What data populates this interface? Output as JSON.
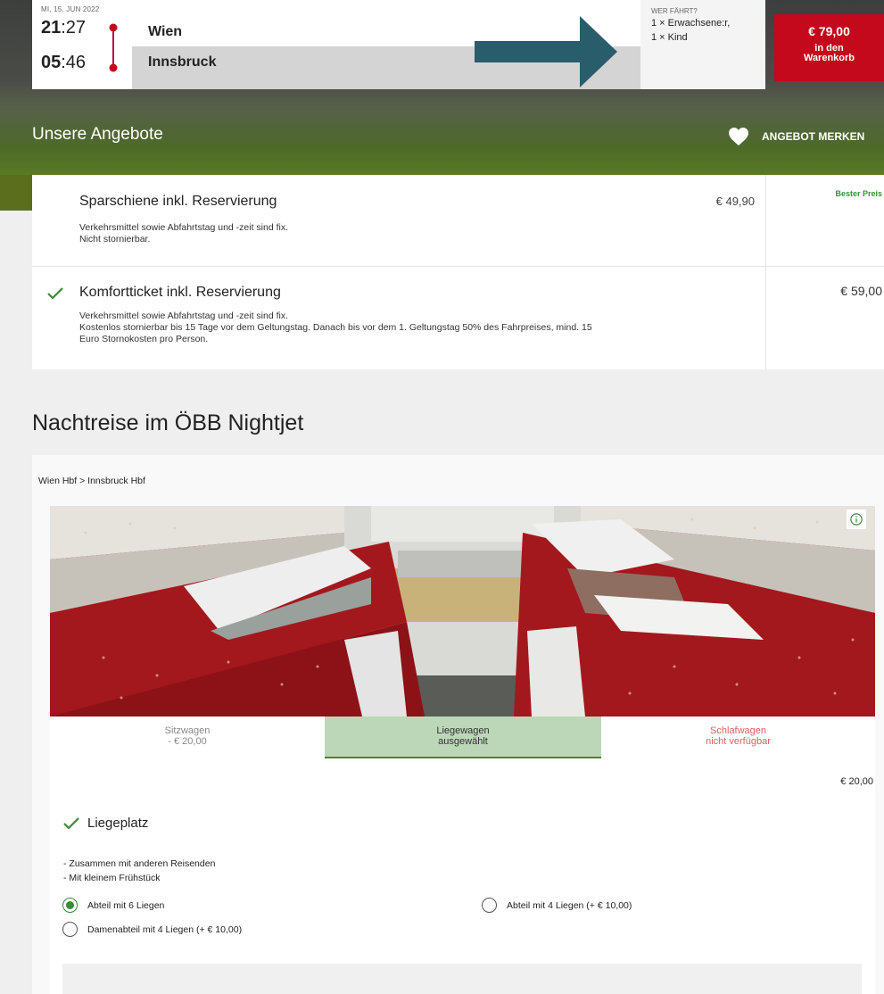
{
  "trip": {
    "date": "MI, 15. JUN 2022",
    "departure_hour": "21",
    "departure_min": ":27",
    "arrival_hour": "05",
    "arrival_min": ":46",
    "from": "Wien",
    "to": "Innsbruck"
  },
  "passengers": {
    "label": "WER FÄHRT?",
    "lines": [
      "1 × Erwachsene:r,",
      "1 × Kind"
    ]
  },
  "cart": {
    "price": "€ 79,00",
    "label_line1": "in den",
    "label_line2": "Warenkorb",
    "color": "#c3091b"
  },
  "offers": {
    "title": "Unsere Angebote",
    "save_label": "ANGEBOT MERKEN",
    "items": [
      {
        "name": "Sparschiene inkl. Reservierung",
        "price": "€ 49,90",
        "badge": "Bester Preis",
        "desc_lines": [
          "Verkehrsmittel sowie Abfahrtstag und -zeit sind fix.",
          "Nicht stornierbar."
        ],
        "selected": false
      },
      {
        "name": "Komfortticket inkl. Reservierung",
        "price": "€ 59,00",
        "desc_lines": [
          "Verkehrsmittel sowie Abfahrtstag und -zeit sind fix.",
          "Kostenlos stornierbar bis 15 Tage vor dem Geltungstag. Danach bis vor dem 1. Geltungstag 50% des Fahrpreises, mind. 15",
          "Euro Stornokosten pro Person."
        ],
        "selected": true
      }
    ]
  },
  "nightjet": {
    "title": "Nachtreise im ÖBB Nightjet",
    "route": "Wien Hbf > Innsbruck Hbf",
    "tabs": [
      {
        "name": "Sitzwagen",
        "sub": "- € 20,00",
        "state": "available"
      },
      {
        "name": "Liegewagen",
        "sub": "ausgewählt",
        "state": "selected"
      },
      {
        "name": "Schlafwagen",
        "sub": "nicht verfügbar",
        "state": "unavailable"
      }
    ],
    "detail_price": "€ 20,00",
    "berth_title": "Liegeplatz",
    "bullets": [
      "- Zusammen mit anderen Reisenden",
      "- Mit kleinem Frühstück"
    ],
    "options": [
      {
        "label": "Abteil mit 6 Liegen",
        "selected": true
      },
      {
        "label": "Abteil mit 4 Liegen (+ € 10,00)",
        "selected": false
      },
      {
        "label": "Damenabteil mit 4 Liegen (+ € 10,00)",
        "selected": false
      }
    ],
    "accent_color": "#3a8a3a"
  }
}
